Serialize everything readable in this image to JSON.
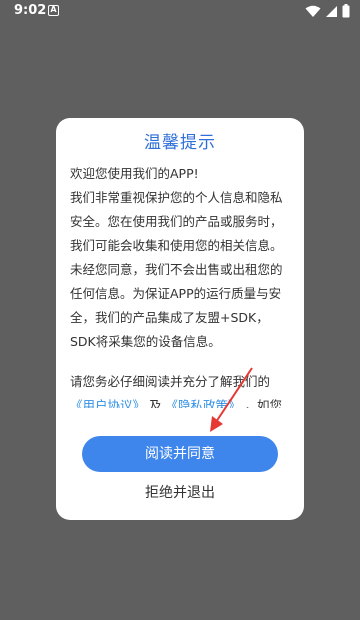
{
  "status_bar": {
    "time": "9:02",
    "notif_letter": "A"
  },
  "dialog": {
    "title": "温馨提示",
    "body": "欢迎您使用我们的APP!\n我们非常重视保护您的个人信息和隐私安全。您在使用我们的产品或服务时，我们可能会收集和使用您的相关信息。未经您同意，我们不会出售或出租您的任何信息。为保证APP的运行质量与安全，我们的产品集成了友盟+SDK，SDK将采集您的设备信息。",
    "agree_prefix": "请您务必仔细阅读并充分了解我们的",
    "user_agreement_link": "《用户协议》",
    "and_text": "及",
    "privacy_link": "《隐私政策》",
    "agree_suffix": "，如您同",
    "agree_button": "阅读并同意",
    "exit_button": "拒绝并退出"
  },
  "colors": {
    "accent": "#3f86ec",
    "title": "#2f6fd9",
    "link": "#2f8fe6",
    "arrow": "#e53935"
  },
  "icons": [
    "wifi-icon",
    "signal-icon",
    "battery-icon"
  ]
}
